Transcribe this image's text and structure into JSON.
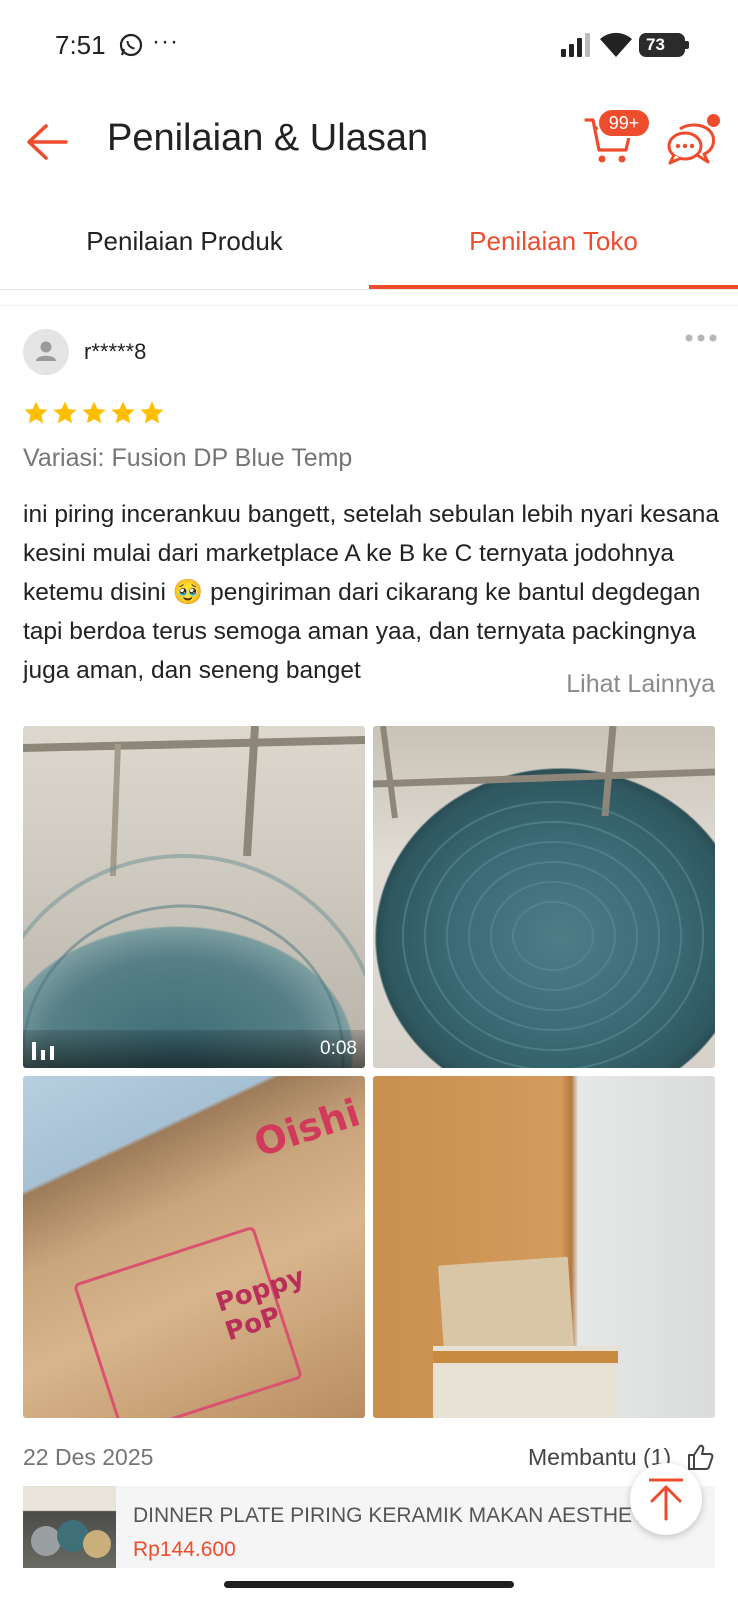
{
  "status_bar": {
    "time": "7:51",
    "battery": "73"
  },
  "header": {
    "title": "Penilaian & Ulasan",
    "cart_badge": "99+"
  },
  "tabs": [
    {
      "label": "Penilaian Produk",
      "active": false
    },
    {
      "label": "Penilaian Toko",
      "active": true
    }
  ],
  "review": {
    "username": "r*****8",
    "rating": 5,
    "variation": "Variasi: Fusion DP Blue Temp",
    "text": "ini piring incerankuu bangett, setelah sebulan lebih nyari kesana kesini mulai dari marketplace A ke B ke C ternyata jodohnya ketemu disini 🥹 pengiriman dari cikarang ke bantul degdegan tapi berdoa terus semoga aman yaa, dan ternyata packingnya juga aman, dan seneng banget",
    "see_more": "Lihat Lainnya",
    "media": [
      {
        "type": "video",
        "duration": "0:08"
      },
      {
        "type": "image"
      },
      {
        "type": "image"
      },
      {
        "type": "image"
      }
    ],
    "date": "22 Des 2025",
    "helpful": "Membantu (1)"
  },
  "product": {
    "name": "DINNER PLATE PIRING KERAMIK MAKAN AESTHETIC...",
    "price": "Rp144.600"
  },
  "colors": {
    "accent": "#ee4d2d",
    "star": "#ffbf00"
  }
}
